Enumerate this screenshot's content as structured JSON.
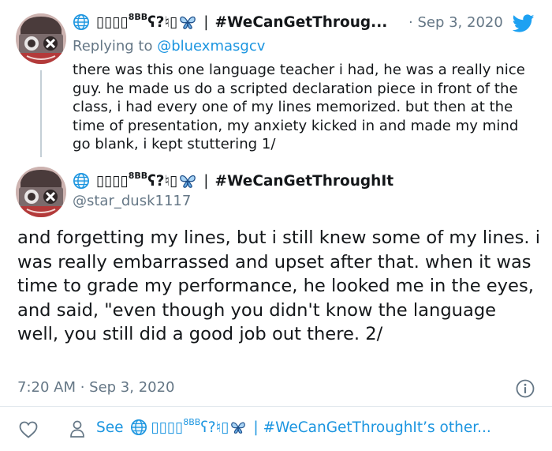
{
  "colors": {
    "accent": "#1b95e0",
    "muted": "#657786",
    "text": "#14171a",
    "twitter_blue": "#1da1f2"
  },
  "tweet1": {
    "display_name_prefix": "▯▯▯▯",
    "display_name_sup": "8BB",
    "display_name_glyphs": "ʕ?♮▯",
    "hashtag": "#WeCanGetThroug...",
    "date": "· Sep 3, 2020",
    "replying_to_label": "Replying to",
    "replying_to_handle": "@bluexmasgcv",
    "text": "there was this one language teacher i had, he was a really nice guy. he made us do a scripted declaration piece in front of the class, i had every one of my lines memorized. but then at the time of presentation, my anxiety kicked in and made my mind go blank, i kept stuttering 1/"
  },
  "tweet2": {
    "display_name_prefix": "▯▯▯▯",
    "display_name_sup": "8BB",
    "display_name_glyphs": "ʕ?♮▯",
    "hashtag": "#WeCanGetThroughIt",
    "handle": "@star_dusk1117",
    "text": "and forgetting my lines, but i still knew some of my lines. i was really embarrassed and upset after that. when it was time to grade my performance, he looked me in the eyes, and said, \"even though you didn't know the language well, you still did a good job out there. 2/",
    "timestamp": "7:20 AM · Sep 3, 2020"
  },
  "footer": {
    "see_label": "See",
    "name_prefix": "▯▯▯▯",
    "name_sup": "8BB",
    "name_glyphs": "ʕ?♮▯",
    "more_label": "#WeCanGetThroughIt’s other..."
  },
  "icons": [
    "avatar",
    "globe-icon",
    "butterfly-icon",
    "twitter-bird-icon",
    "info-icon",
    "heart-icon",
    "person-icon"
  ]
}
